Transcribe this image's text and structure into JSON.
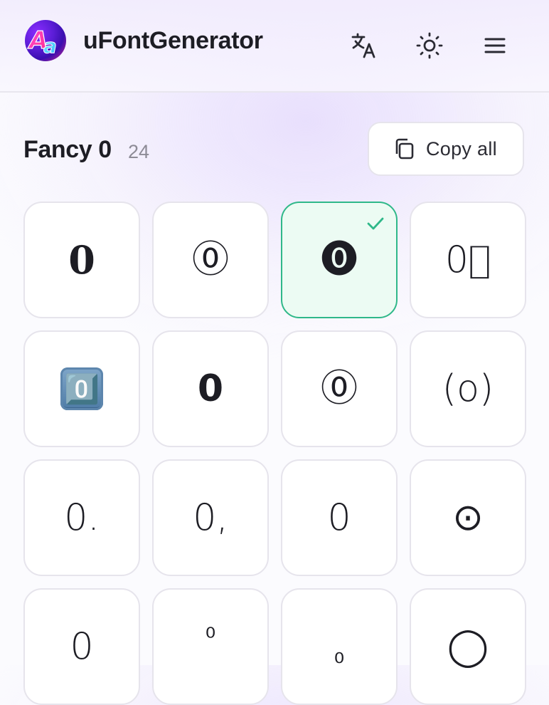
{
  "app": {
    "title": "uFontGenerator",
    "logo_text": "Aa"
  },
  "header": {
    "icons": [
      "translate-icon",
      "sun-icon",
      "menu-icon"
    ]
  },
  "section": {
    "title": "Fancy 0",
    "count": "24"
  },
  "copy_all": {
    "label": "Copy all",
    "icon": "copy-icon"
  },
  "colors": {
    "accent_green": "#2fb889",
    "selected_bg": "#ecfbf3",
    "text": "#1d1d24",
    "muted": "#8d8b96"
  },
  "variants": [
    {
      "glyph": "𝟎",
      "selected": false
    },
    {
      "glyph": "⓪",
      "selected": false
    },
    {
      "glyph": "⓿",
      "selected": true
    },
    {
      "glyph": "0⃒",
      "selected": false
    },
    {
      "glyph": "0️⃣",
      "selected": false
    },
    {
      "glyph": "𝟬",
      "selected": false
    },
    {
      "glyph": "⓪",
      "selected": false
    },
    {
      "glyph": "(o)",
      "selected": false
    },
    {
      "glyph": "0.",
      "selected": false
    },
    {
      "glyph": "0,",
      "selected": false
    },
    {
      "glyph": "0",
      "selected": false
    },
    {
      "glyph": "⊙",
      "selected": false
    },
    {
      "glyph": "0",
      "selected": false
    },
    {
      "glyph": "⁰",
      "selected": false
    },
    {
      "glyph": "₀",
      "selected": false
    },
    {
      "glyph": "◯",
      "selected": false
    }
  ]
}
